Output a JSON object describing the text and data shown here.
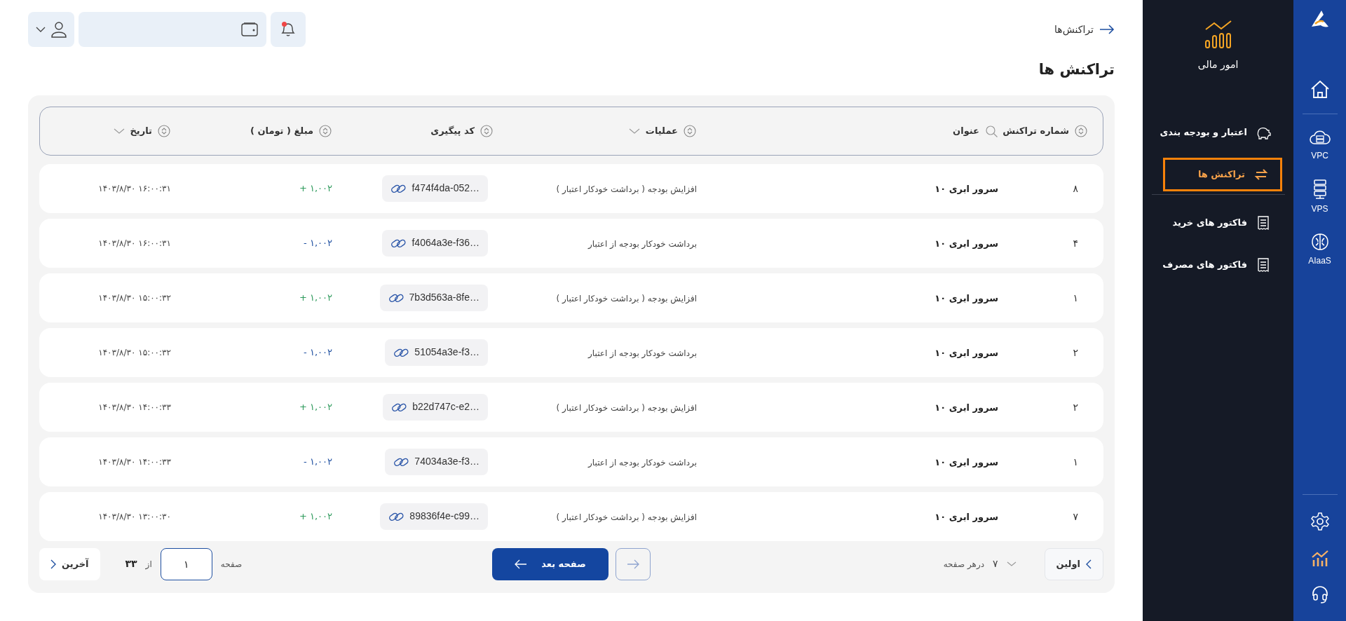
{
  "rail": {
    "items": [
      {
        "kind": "home",
        "selected": false
      },
      {
        "kind": "vpc",
        "label": "VPC",
        "selected": false
      },
      {
        "kind": "vps",
        "label": "VPS",
        "selected": false
      },
      {
        "kind": "aiaas",
        "label": "AIaaS",
        "selected": false
      },
      {
        "kind": "settings",
        "selected": false
      },
      {
        "kind": "finance",
        "selected": true
      },
      {
        "kind": "support",
        "selected": false
      }
    ]
  },
  "sidebar": {
    "title": "امور مالی",
    "groups": [
      [
        {
          "kind": "piggy",
          "label": "اعتبار و بودجه بندی",
          "selected": false
        },
        {
          "kind": "transfer",
          "label": "تراکنش ها",
          "selected": true
        }
      ],
      [
        {
          "kind": "invoice",
          "label": "فاکتور های خرید",
          "selected": false
        },
        {
          "kind": "invoice",
          "label": "فاکتور های مصرف",
          "selected": false
        }
      ]
    ]
  },
  "breadcrumb": {
    "label": "تراکنش‌ها"
  },
  "topbar": {
    "notifications": {
      "unread": true
    }
  },
  "page_title": "تراکنش ها",
  "table": {
    "columns": [
      {
        "label": "شماره تراکنش",
        "kind": "sort"
      },
      {
        "label": "عنوان",
        "kind": "search"
      },
      {
        "label": "عملیات",
        "kind": "sort_menu"
      },
      {
        "label": "کد پیگیری",
        "kind": "sort"
      },
      {
        "label": "مبلغ ( تومان )",
        "kind": "sort"
      },
      {
        "label": "تاریخ",
        "kind": "sort_menu"
      }
    ],
    "rows": [
      {
        "number": "۸",
        "title": "سرور ابری ۱۰",
        "operation": "افزایش بودجه ( برداشت خودکار اعتبار )",
        "tracking_code": "f474f4da-052…",
        "sign": "+",
        "amount": "۱,۰۰۲",
        "kind": "credit",
        "date": "۱۴۰۳/۸/۳۰ ۱۶:۰۰:۳۱"
      },
      {
        "number": "۴",
        "title": "سرور ابری ۱۰",
        "operation": "برداشت خودکار بودجه از اعتبار",
        "tracking_code": "f4064a3e-f36…",
        "sign": "-",
        "amount": "۱,۰۰۲",
        "kind": "debit",
        "date": "۱۴۰۳/۸/۳۰ ۱۶:۰۰:۳۱"
      },
      {
        "number": "۱",
        "title": "سرور ابری ۱۰",
        "operation": "افزایش بودجه ( برداشت خودکار اعتبار )",
        "tracking_code": "7b3d563a-8fe…",
        "sign": "+",
        "amount": "۱,۰۰۲",
        "kind": "credit",
        "date": "۱۴۰۳/۸/۳۰ ۱۵:۰۰:۳۲"
      },
      {
        "number": "۲",
        "title": "سرور ابری ۱۰",
        "operation": "برداشت خودکار بودجه از اعتبار",
        "tracking_code": "51054a3e-f3…",
        "sign": "-",
        "amount": "۱,۰۰۲",
        "kind": "debit",
        "date": "۱۴۰۳/۸/۳۰ ۱۵:۰۰:۳۲"
      },
      {
        "number": "۲",
        "title": "سرور ابری ۱۰",
        "operation": "افزایش بودجه ( برداشت خودکار اعتبار )",
        "tracking_code": "b22d747c-e2…",
        "sign": "+",
        "amount": "۱,۰۰۲",
        "kind": "credit",
        "date": "۱۴۰۳/۸/۳۰ ۱۴:۰۰:۳۳"
      },
      {
        "number": "۱",
        "title": "سرور ابری ۱۰",
        "operation": "برداشت خودکار بودجه از اعتبار",
        "tracking_code": "74034a3e-f3…",
        "sign": "-",
        "amount": "۱,۰۰۲",
        "kind": "debit",
        "date": "۱۴۰۳/۸/۳۰ ۱۴:۰۰:۳۳"
      },
      {
        "number": "۷",
        "title": "سرور ابری ۱۰",
        "operation": "افزایش بودجه ( برداشت خودکار اعتبار )",
        "tracking_code": "89836f4e-c99…",
        "sign": "+",
        "amount": "۱,۰۰۲",
        "kind": "credit",
        "date": "۱۴۰۳/۸/۳۰ ۱۳:۰۰:۳۰"
      }
    ]
  },
  "pagination": {
    "first_label": "اولین",
    "page_size": "۷",
    "page_size_label": "درهر صفحه",
    "previous_disabled": true,
    "next_label": "صفحه بعد",
    "page_label": "صفحه",
    "page": "۱",
    "of_label": "از",
    "total_pages": "۳۳",
    "last_label": "آخرین"
  }
}
